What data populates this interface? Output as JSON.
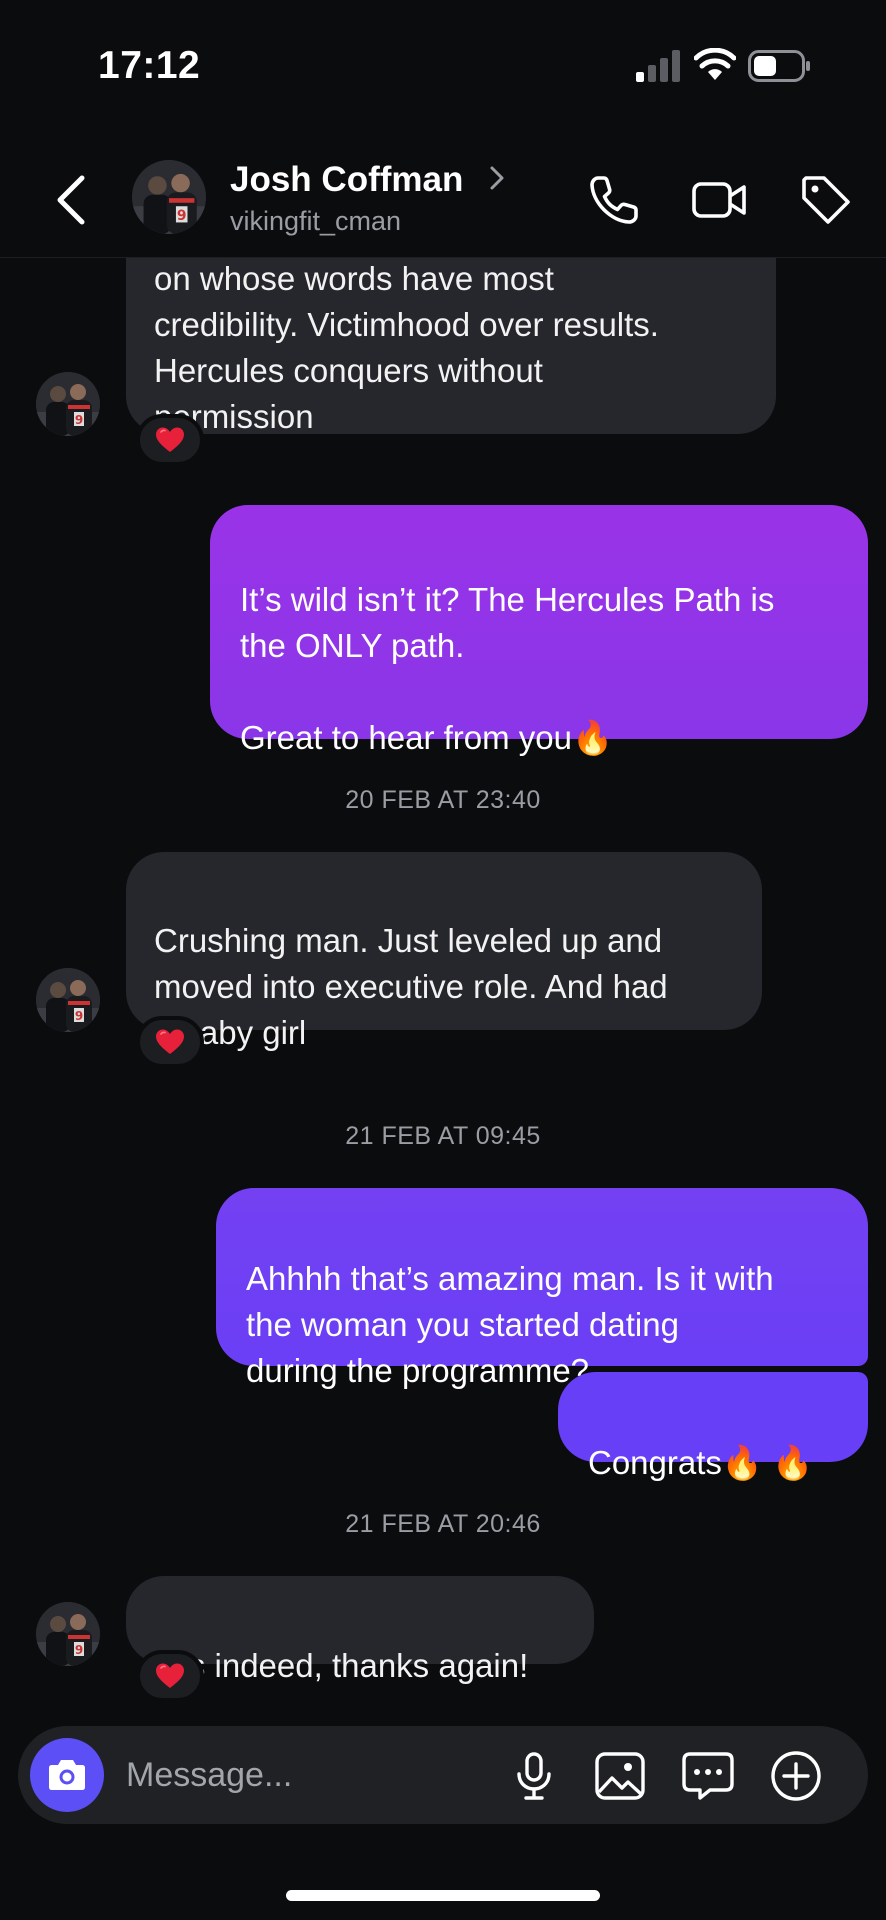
{
  "status_bar": {
    "time": "17:12",
    "icons": [
      "signal-icon",
      "wifi-icon",
      "battery-icon"
    ]
  },
  "header": {
    "contact_name": "Josh Coffman",
    "contact_handle": "vikingfit_cman",
    "icons": [
      "back-icon",
      "chevron-right-icon",
      "phone-icon",
      "video-camera-icon",
      "tag-icon"
    ]
  },
  "messages": [
    {
      "direction": "in",
      "text": "on whose words have most\ncredibility. Victimhood over results.\nHercules conquers without\npermission",
      "reaction": "❤️"
    },
    {
      "direction": "out",
      "text": "It’s wild isn’t it? The Hercules Path is\nthe ONLY path.\n\nGreat to hear from you🔥"
    },
    {
      "type": "timestamp",
      "text": "20 FEB AT 23:40"
    },
    {
      "direction": "in",
      "text": "Crushing man. Just leveled up and\nmoved into executive role. And had\na baby girl",
      "reaction": "❤️"
    },
    {
      "type": "timestamp",
      "text": "21 FEB AT 09:45"
    },
    {
      "direction": "out",
      "text": "Ahhhh that’s amazing man. Is it with\nthe woman you started dating\nduring the programme?"
    },
    {
      "direction": "out",
      "text": "Congrats🔥 🔥"
    },
    {
      "type": "timestamp",
      "text": "21 FEB AT 20:46"
    },
    {
      "direction": "in",
      "text": "It is indeed, thanks again!",
      "reaction": "❤️"
    }
  ],
  "composer": {
    "placeholder": "Message...",
    "icons": [
      "camera-icon",
      "microphone-icon",
      "image-icon",
      "sticker-chat-icon",
      "plus-icon"
    ]
  },
  "colors": {
    "background": "#0b0c0e",
    "incoming_bubble": "#25272c",
    "outgoing_purple": "#9a33e8",
    "outgoing_indigo": "#6a3ff5",
    "camera_button": "#5b4ff5",
    "reaction_heart": "#e8213b"
  }
}
